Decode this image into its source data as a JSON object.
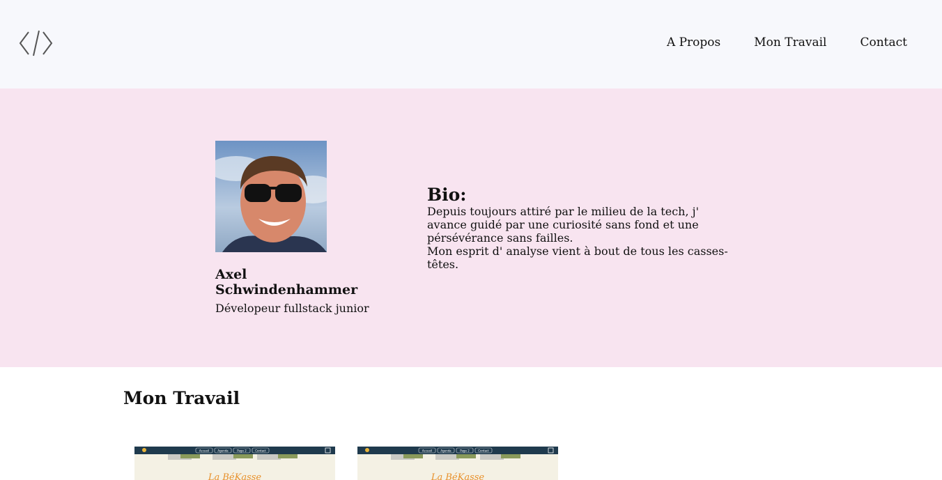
{
  "header": {
    "logo_icon": "code-brackets-icon",
    "nav": [
      {
        "label": "A Propos"
      },
      {
        "label": "Mon Travail"
      },
      {
        "label": "Contact"
      }
    ]
  },
  "profile": {
    "name": "Axel Schwindenhammer",
    "role": "Dévelopeur fullstack junior",
    "photo_icon": "profile-photo"
  },
  "bio": {
    "title": "Bio:",
    "line1": "Depuis toujours attiré par le milieu de la tech, j' avance guidé par une curiosité sans fond et une pérsévérance sans failles.",
    "line2": "Mon esprit d' analyse vient à bout de tous les casses-têtes."
  },
  "work": {
    "title": "Mon Travail",
    "cards": [
      {
        "brand": "La BéKasse",
        "menu": [
          "Accueil",
          "Agenda",
          "Page 2",
          "Contact"
        ]
      },
      {
        "brand": "La BéKasse",
        "menu": [
          "Accueil",
          "Agenda",
          "Page 2",
          "Contact"
        ]
      }
    ]
  },
  "colors": {
    "header_bg": "#f7f8fc",
    "hero_bg": "#f8e4f0",
    "card_nav_bg": "#1f3a4d",
    "card_body_bg": "#f4f1e4",
    "card_brand": "#e8902a"
  }
}
